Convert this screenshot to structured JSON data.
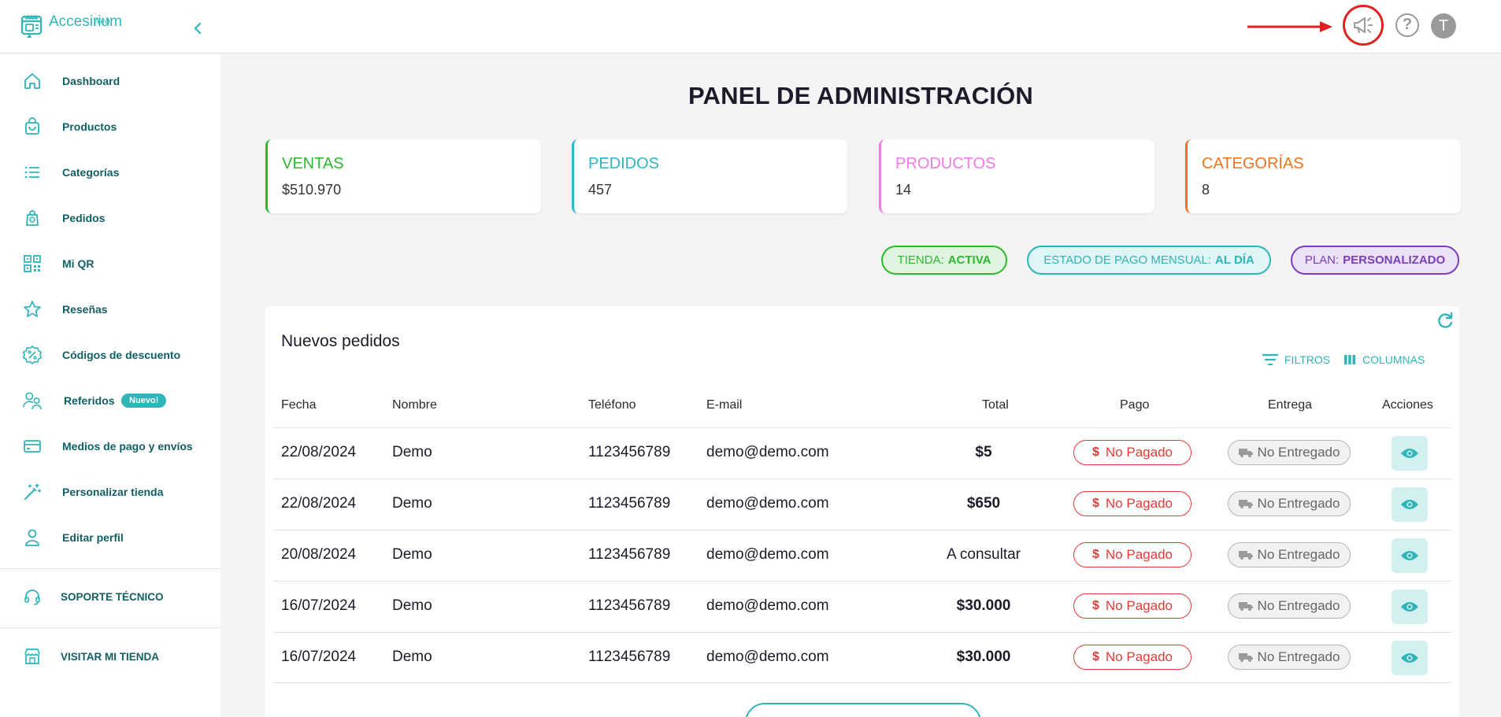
{
  "app": {
    "brand": "Accesirium",
    "brand_sub": "Web"
  },
  "topbar": {
    "avatar_initial": "T",
    "help_symbol": "?"
  },
  "sidebar": {
    "items": [
      {
        "label": "Dashboard",
        "icon": "home-icon"
      },
      {
        "label": "Productos",
        "icon": "shopping-bag-icon"
      },
      {
        "label": "Categorías",
        "icon": "list-icon"
      },
      {
        "label": "Pedidos",
        "icon": "package-icon"
      },
      {
        "label": "Mi QR",
        "icon": "qr-code-icon"
      },
      {
        "label": "Reseñas",
        "icon": "star-icon"
      },
      {
        "label": "Códigos de descuento",
        "icon": "discount-icon"
      },
      {
        "label": "Referidos",
        "icon": "referral-users-icon",
        "badge": "Nuevo!"
      },
      {
        "label": "Medios de pago y envíos",
        "icon": "credit-card-icon"
      },
      {
        "label": "Personalizar tienda",
        "icon": "magic-wand-icon"
      },
      {
        "label": "Editar perfil",
        "icon": "user-icon"
      }
    ],
    "support_label": "SOPORTE TÉCNICO",
    "visit_label": "VISITAR MI TIENDA"
  },
  "main": {
    "title": "PANEL DE ADMINISTRACIÓN",
    "stats": [
      {
        "label": "VENTAS",
        "value": "$510.970",
        "color": "#2eb82e"
      },
      {
        "label": "PEDIDOS",
        "value": "457",
        "color": "#2fb4c8"
      },
      {
        "label": "PRODUCTOS",
        "value": "14",
        "color": "#f07ae6"
      },
      {
        "label": "CATEGORÍAS",
        "value": "8",
        "color": "#f2731e"
      }
    ],
    "status": [
      {
        "label": "TIENDA:",
        "value": "ACTIVA",
        "color": "#2eb82e",
        "bg": "#dff5df"
      },
      {
        "label": "ESTADO DE PAGO MENSUAL:",
        "value": "AL DÍA",
        "color": "#2fb4b8",
        "bg": "#e0f5f6"
      },
      {
        "label": "PLAN:",
        "value": "PERSONALIZADO",
        "color": "#7a3fb8",
        "bg": "#ece2f7"
      }
    ]
  },
  "orders": {
    "title": "Nuevos pedidos",
    "filters_label": "FILTROS",
    "columns_label": "COLUMNAS",
    "headers": {
      "fecha": "Fecha",
      "nombre": "Nombre",
      "telefono": "Teléfono",
      "email": "E-mail",
      "total": "Total",
      "pago": "Pago",
      "entrega": "Entrega",
      "acciones": "Acciones"
    },
    "rows": [
      {
        "fecha": "22/08/2024",
        "nombre": "Demo",
        "telefono": "1123456789",
        "email": "demo@demo.com",
        "total": "$5",
        "pago": "No Pagado",
        "entrega": "No Entregado"
      },
      {
        "fecha": "22/08/2024",
        "nombre": "Demo",
        "telefono": "1123456789",
        "email": "demo@demo.com",
        "total": "$650",
        "pago": "No Pagado",
        "entrega": "No Entregado"
      },
      {
        "fecha": "20/08/2024",
        "nombre": "Demo",
        "telefono": "1123456789",
        "email": "demo@demo.com",
        "total": "A consultar",
        "pago": "No Pagado",
        "entrega": "No Entregado"
      },
      {
        "fecha": "16/07/2024",
        "nombre": "Demo",
        "telefono": "1123456789",
        "email": "demo@demo.com",
        "total": "$30.000",
        "pago": "No Pagado",
        "entrega": "No Entregado"
      },
      {
        "fecha": "16/07/2024",
        "nombre": "Demo",
        "telefono": "1123456789",
        "email": "demo@demo.com",
        "total": "$30.000",
        "pago": "No Pagado",
        "entrega": "No Entregado"
      }
    ],
    "currency_symbol": "$"
  },
  "colors": {
    "accent": "#2fb4b8",
    "nav_text": "#0f5f63",
    "unpaid": "#e53935",
    "highlight_ring": "#e02020"
  }
}
